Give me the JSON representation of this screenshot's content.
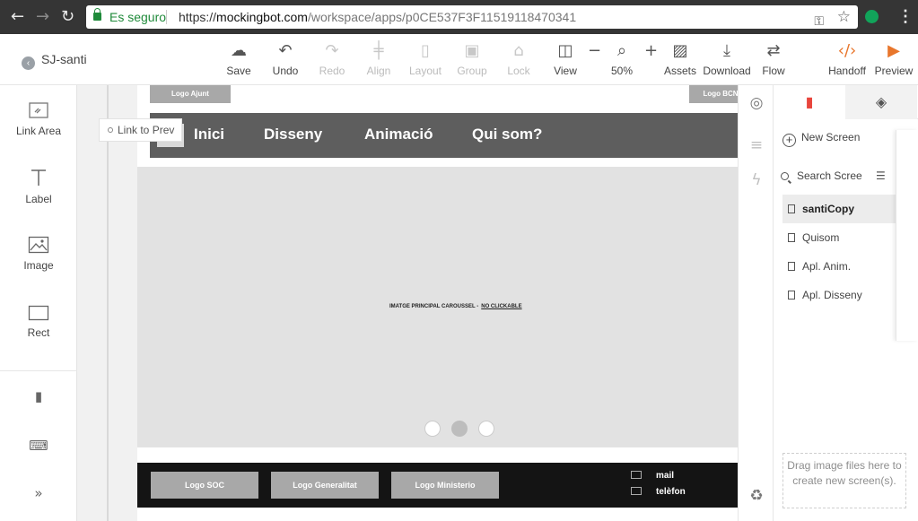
{
  "browser": {
    "secure_label": "Es seguro",
    "url_scheme": "https://",
    "url_host": "mockingbot.com",
    "url_path": "/workspace/apps/p0CE537F3F11519118470341"
  },
  "project": {
    "name": "SJ-santi"
  },
  "toolbar": {
    "save": "Save",
    "undo": "Undo",
    "redo": "Redo",
    "align": "Align",
    "layout": "Layout",
    "group": "Group",
    "lock": "Lock",
    "view": "View",
    "zoom": "50%",
    "assets": "Assets",
    "download": "Download",
    "flow": "Flow",
    "handoff": "Handoff",
    "preview": "Preview"
  },
  "left_tools": [
    {
      "label": "Link Area"
    },
    {
      "label": "Label"
    },
    {
      "label": "Image"
    },
    {
      "label": "Rect"
    }
  ],
  "canvas": {
    "logo_left": "Logo Ajunt",
    "logo_right": "Logo BCN",
    "link_to_prev": "Link to Prev",
    "menu": [
      "Inici",
      "Disseny",
      "Animació",
      "Qui som?"
    ],
    "carousel_caption": "IMATGE PRINCIPAL CAROUSSEL -",
    "carousel_caption_link": "NO CLICKABLE",
    "carousel_active_dot": 2,
    "footer_logos": [
      "Logo SOC",
      "Logo Generalitat",
      "Logo Ministerio"
    ],
    "footer_contacts": [
      "mail",
      "telèfon"
    ]
  },
  "screens_panel": {
    "new_screen": "New Screen",
    "search_placeholder": "Search Scree",
    "screens": [
      "santiCopy",
      "Quisom",
      "Apl. Anim.",
      "Apl. Disseny"
    ],
    "selected_screen": "santiCopy",
    "dropzone_text": "Drag image files here to create new screen(s)."
  },
  "colors": {
    "secure_green": "#1f8a3a",
    "menu_bar": "#5e5e5e",
    "footer": "#141414",
    "active_tab_icon": "#e8453c"
  }
}
